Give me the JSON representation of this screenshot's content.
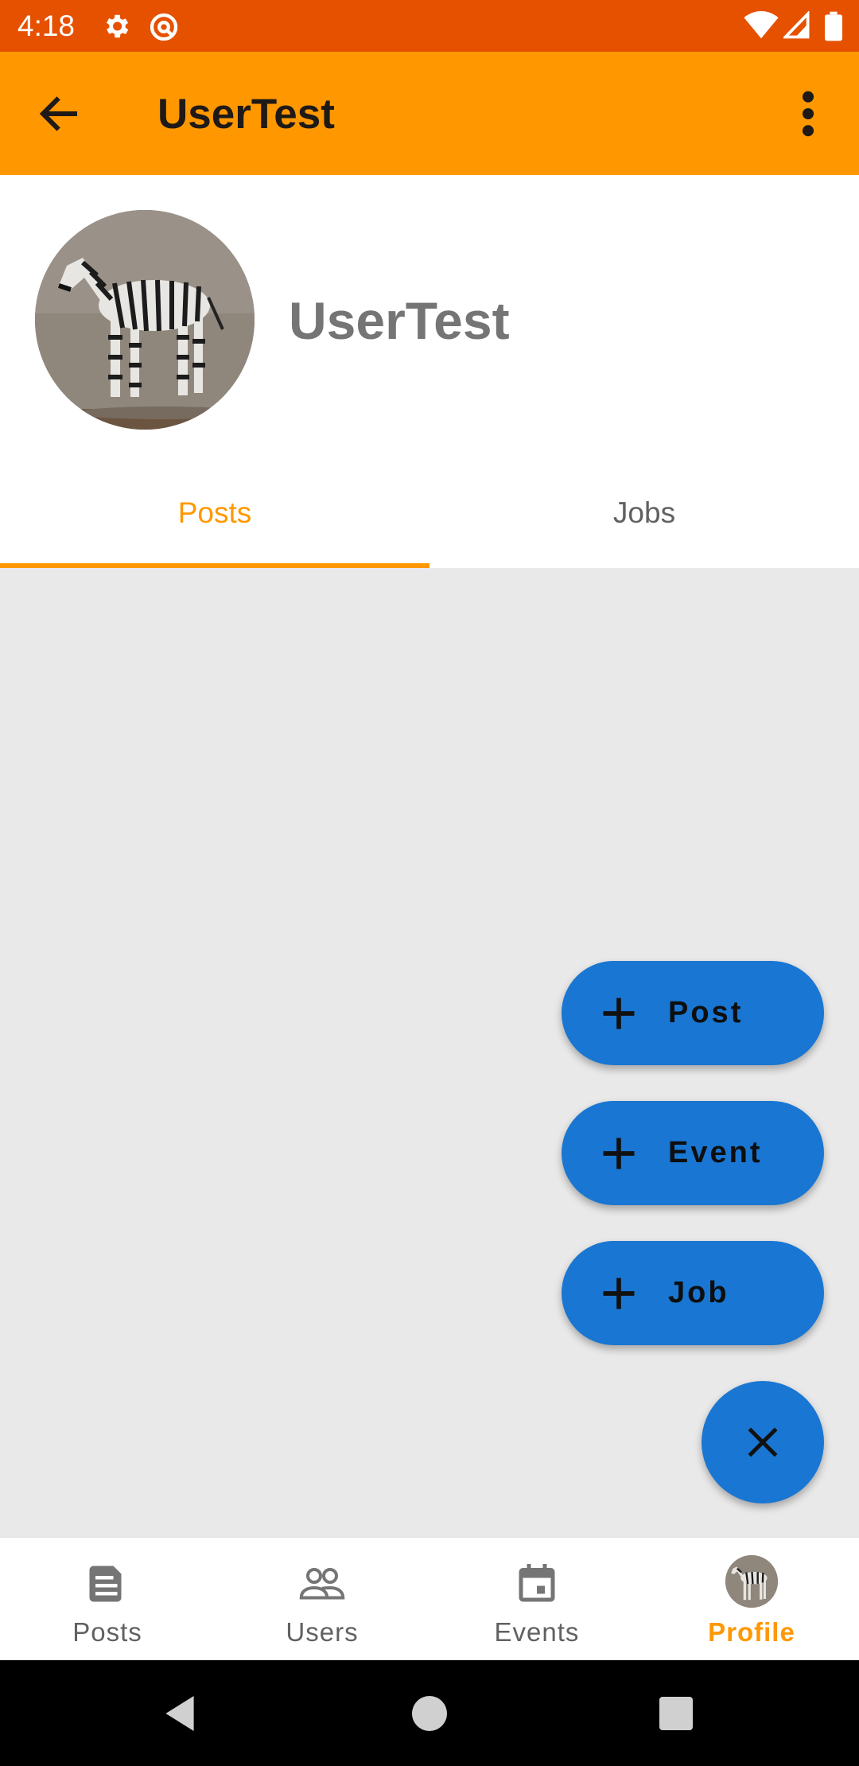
{
  "status_bar": {
    "time": "4:18",
    "icons": [
      "gear-icon",
      "vpn-icon",
      "wifi-icon",
      "signal-icon",
      "battery-icon"
    ]
  },
  "app_bar": {
    "title": "UserTest",
    "background": "#ff9800"
  },
  "profile": {
    "name": "UserTest",
    "avatar": "zebra-photo"
  },
  "tabs": [
    {
      "label": "Posts",
      "selected": true
    },
    {
      "label": "Jobs",
      "selected": false
    }
  ],
  "fab_menu": {
    "items": [
      {
        "label": "Post",
        "icon": "plus-icon"
      },
      {
        "label": "Event",
        "icon": "plus-icon"
      },
      {
        "label": "Job",
        "icon": "plus-icon"
      }
    ],
    "close_icon": "close-icon",
    "color": "#1976d2"
  },
  "bottom_nav": {
    "items": [
      {
        "label": "Posts",
        "icon": "posts-icon",
        "active": false
      },
      {
        "label": "Users",
        "icon": "users-icon",
        "active": false
      },
      {
        "label": "Events",
        "icon": "events-icon",
        "active": false
      },
      {
        "label": "Profile",
        "icon": "avatar",
        "active": true
      }
    ],
    "accent": "#ff9800"
  }
}
